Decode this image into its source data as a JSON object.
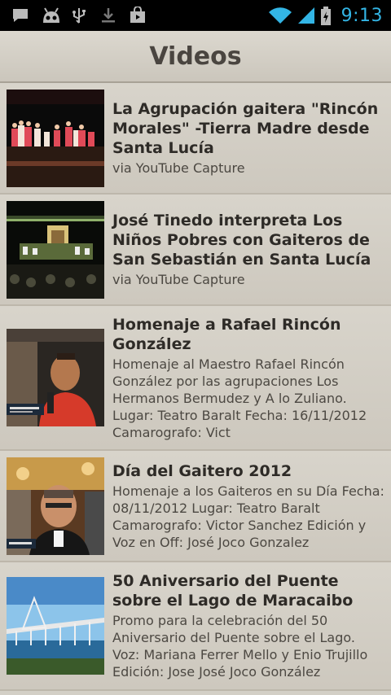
{
  "status_bar": {
    "time": "9:13",
    "icons": [
      "chat-icon",
      "android-icon",
      "usb-icon",
      "download-icon",
      "shop-icon",
      "wifi-icon",
      "signal-icon",
      "battery-icon"
    ],
    "time_color": "#33b5e5"
  },
  "header": {
    "title": "Videos"
  },
  "videos": [
    {
      "title": "La Agrupación gaitera \"Rincón Morales\" -Tierra Madre desde Santa Lucía",
      "description": "via YouTube Capture"
    },
    {
      "title": "José Tinedo interpreta Los Niños Pobres con Gaiteros de San Sebastián en Santa Lucía",
      "description": "via YouTube Capture"
    },
    {
      "title": "Homenaje a Rafael Rincón González",
      "description": "Homenaje al Maestro Rafael Rincón González por las agrupaciones Los Hermanos Bermudez y A lo Zuliano. Lugar: Teatro Baralt Fecha: 16/11/2012 Camarografo: Vict"
    },
    {
      "title": "Día del Gaitero 2012",
      "description": "Homenaje a los Gaiteros en su Día Fecha: 08/11/2012 Lugar: Teatro Baralt Camarografo: Victor Sanchez Edición y Voz en Off: José Joco Gonzalez"
    },
    {
      "title": "50 Aniversario del Puente sobre el Lago de Maracaibo",
      "description": "Promo para la celebración del 50 Aniversario del Puente sobre el Lago. Voz: Mariana Ferrer Mello y Enio Trujillo Edición: Jose José Joco González"
    }
  ]
}
